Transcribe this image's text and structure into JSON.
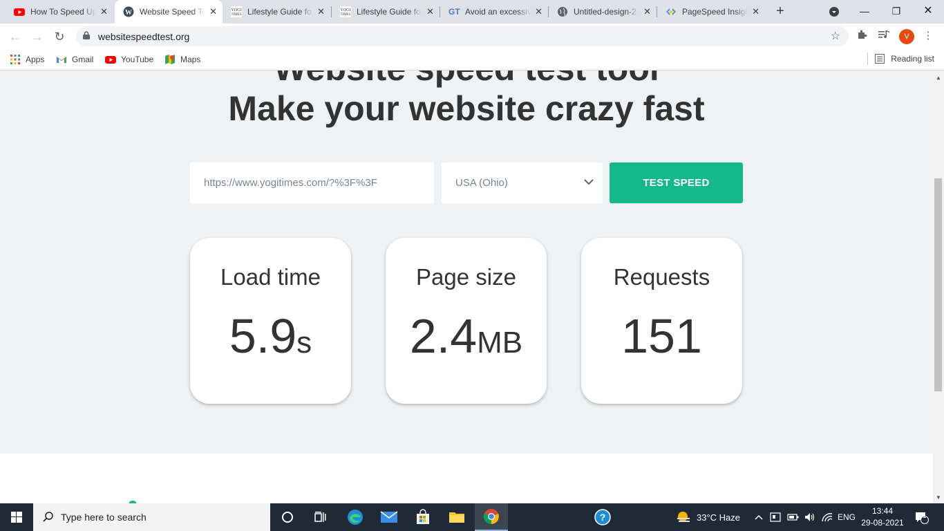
{
  "browser": {
    "tabs": [
      {
        "title": "How To Speed Up",
        "icon": "youtube-icon",
        "active": false
      },
      {
        "title": "Website Speed Te",
        "icon": "wordpress-icon",
        "active": true
      },
      {
        "title": "Lifestyle Guide fo",
        "icon": "yogitimes-icon",
        "active": false
      },
      {
        "title": "Lifestyle Guide fo",
        "icon": "yogitimes-icon",
        "active": false
      },
      {
        "title": "Avoid an excessiv",
        "icon": "gtmetrix-icon",
        "active": false
      },
      {
        "title": "Untitled-design-2",
        "icon": "globe-icon",
        "active": false
      },
      {
        "title": "PageSpeed Insigh",
        "icon": "pagespeed-icon",
        "active": false
      }
    ],
    "url": "websitespeedtest.org",
    "profile_initial": "V",
    "bookmarks": [
      {
        "label": "Apps",
        "icon": "apps-grid-icon"
      },
      {
        "label": "Gmail",
        "icon": "gmail-icon"
      },
      {
        "label": "YouTube",
        "icon": "youtube-icon"
      },
      {
        "label": "Maps",
        "icon": "maps-icon"
      }
    ],
    "reading_list": "Reading list"
  },
  "page": {
    "heading_cut": "Website speed test tool",
    "heading": "Make your website crazy fast",
    "url_input_value": "https://www.yogitimes.com/?%3F%3F",
    "region": "USA (Ohio)",
    "test_button": "TEST SPEED",
    "metrics": {
      "load_time": {
        "label": "Load time",
        "value": "5.9",
        "unit": "s"
      },
      "page_size": {
        "label": "Page size",
        "value": "2.4",
        "unit": "MB"
      },
      "requests": {
        "label": "Requests",
        "value": "151",
        "unit": ""
      }
    }
  },
  "taskbar": {
    "search_placeholder": "Type here to search",
    "weather": "33°C  Haze",
    "language": "ENG",
    "time": "13:44",
    "date": "29-08-2021",
    "notification_count": "1"
  },
  "colors": {
    "accent": "#14b88b",
    "page_bg": "#eef2f5",
    "taskbar_bg": "#1f2a36"
  }
}
